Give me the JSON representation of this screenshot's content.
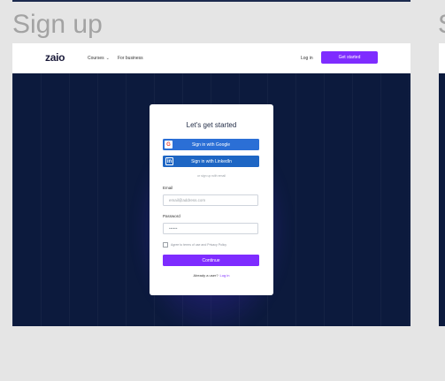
{
  "page": {
    "heading": "Sign up",
    "next_heading": "S"
  },
  "navbar": {
    "logo": "zaio",
    "courses_label": "Courses",
    "business_label": "For business",
    "login_label": "Log in",
    "cta_label": "Get started"
  },
  "card": {
    "title": "Let's get started",
    "google_label": "Sign in with Google",
    "linkedin_label": "Sign in with LinkedIn",
    "divider": "or sign up with email",
    "email_label": "Email",
    "email_placeholder": "email@address.com",
    "password_label": "Password",
    "password_value": "••••••",
    "agree_text": "Agree to terms of use and Privacy Policy",
    "continue_label": "Continue",
    "already_text": "Already a user?",
    "login_link": "Log in"
  },
  "colors": {
    "accent": "#7e2cff",
    "sso_blue": "#2b6fd6",
    "hero_bg": "#0c1a3d",
    "canvas_bg": "#e5e5e5"
  },
  "icons": {
    "google": "google-icon",
    "linkedin": "linkedin-icon",
    "chevron": "chevron-down-icon"
  }
}
